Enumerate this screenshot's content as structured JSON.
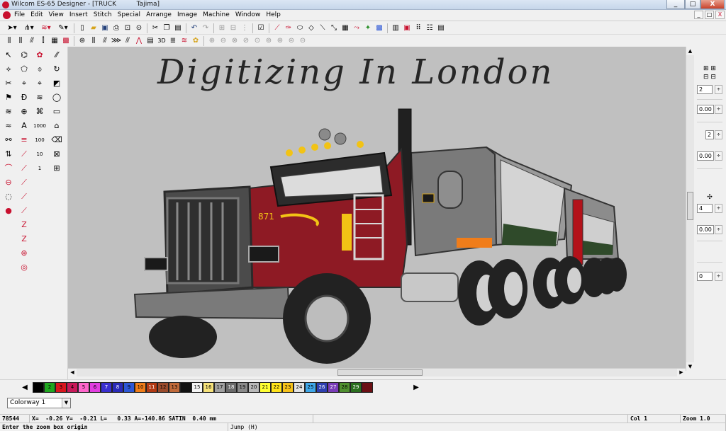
{
  "window": {
    "title": "Wilcom ES-65 Designer - [TRUCK          Tajima]",
    "minimize_glyph": "_",
    "maximize_glyph": "□",
    "close_glyph": "X"
  },
  "menu": {
    "items": [
      "File",
      "Edit",
      "View",
      "Insert",
      "Stitch",
      "Special",
      "Arrange",
      "Image",
      "Machine",
      "Window",
      "Help"
    ],
    "mdi_min": "_",
    "mdi_restore": "□",
    "mdi_close": "X"
  },
  "toolbar": {
    "rows": [
      [
        "select-arrow-icon",
        "stitch-tool-icon",
        "fill-tool-icon",
        "pen-icon",
        "new-file-icon",
        "open-folder-icon",
        "save-icon",
        "print-icon",
        "print-preview-icon",
        "zoom-icon",
        "cut-icon",
        "copy-icon",
        "paste-icon",
        "undo-icon",
        "redo-icon",
        "group-icon",
        "ungroup-icon",
        "align-icon",
        "checkbox-icon",
        "needle-icon",
        "brush-icon",
        "outline-icon",
        "shape-icon",
        "wand-icon",
        "grid-icon",
        "redraw-icon",
        "color-icon",
        "picture-icon",
        "layout-icon",
        "palette-icon",
        "thread-icon",
        "options-icon"
      ],
      [
        "run-stitch-icon",
        "fill-stitch-icon",
        "satin-icon",
        "column-icon",
        "tatami-icon",
        "motif-icon",
        "pattern-icon",
        "stamp-icon",
        "cross-stitch-icon",
        "zigzag-icon",
        "fan-icon",
        "triangle-icon",
        "shape-fill-icon",
        "3d-icon",
        "embossed-icon",
        "contour-icon",
        "sequin-icon",
        "corner-icon",
        "chain-icon",
        "spiral-icon",
        "star-icon",
        "stipple-icon",
        "gradient-icon",
        "offset-icon"
      ]
    ],
    "row2_text": "3D"
  },
  "left_tools": {
    "col1": [
      "↖",
      "⟡",
      "✂",
      "⚑",
      "≋",
      "≈",
      "⚯",
      "⇅",
      "⌒",
      "⊖",
      "◌",
      "●"
    ],
    "col2": [
      "⌬",
      "⬠",
      "⌖",
      "Ð",
      "⊕",
      "A",
      "≡",
      "⟋",
      "⟋",
      "⟋",
      "⟋",
      "⟋",
      "Z",
      "Z",
      "⊛",
      "◎"
    ],
    "col3": [
      "✿",
      "⌽",
      "⌖",
      "≋",
      "⌘",
      "1000",
      "100",
      "10",
      "1"
    ],
    "col4": [
      "⁄⁄",
      "↻",
      "◩",
      "◯",
      "▭",
      "⌂",
      "⌫",
      "⊠",
      "⊞"
    ]
  },
  "canvas": {
    "heading": "Digitizing In London",
    "truck_number": "871"
  },
  "colors": {
    "canvas_bg": "#c0c0c0",
    "truck_red": "#8e1a24",
    "truck_dark": "#2c2c2c",
    "trailer_grey": "#8c8c8c",
    "accent_yellow": "#f2c315"
  },
  "right_panel": {
    "fields": [
      "2",
      "0.00",
      "2",
      "0.00",
      "4",
      "0.00",
      "0"
    ]
  },
  "palette": {
    "swatches": [
      {
        "label": "",
        "color": "#000000"
      },
      {
        "label": "2",
        "color": "#1fa61f"
      },
      {
        "label": "3",
        "color": "#d8161e"
      },
      {
        "label": "4",
        "color": "#c81a5a"
      },
      {
        "label": "5",
        "color": "#ff66cc"
      },
      {
        "label": "6",
        "color": "#e23ee0"
      },
      {
        "label": "7",
        "color": "#3a2fd0"
      },
      {
        "label": "8",
        "color": "#2a2ab8"
      },
      {
        "label": "9",
        "color": "#2d57d6"
      },
      {
        "label": "10",
        "color": "#f07d1a"
      },
      {
        "label": "11",
        "color": "#b23a14"
      },
      {
        "label": "12",
        "color": "#9a4b2c"
      },
      {
        "label": "13",
        "color": "#c06a3a"
      },
      {
        "label": "",
        "color": "#111111"
      },
      {
        "label": "15",
        "color": "#f5f5f5"
      },
      {
        "label": "16",
        "color": "#f6e27a"
      },
      {
        "label": "17",
        "color": "#a0a0a0"
      },
      {
        "label": "18",
        "color": "#6a6a6a"
      },
      {
        "label": "19",
        "color": "#8a8a8a"
      },
      {
        "label": "20",
        "color": "#b9b9b9"
      },
      {
        "label": "21",
        "color": "#ffff33"
      },
      {
        "label": "22",
        "color": "#ffe31a"
      },
      {
        "label": "23",
        "color": "#f6c21a"
      },
      {
        "label": "24",
        "color": "#e4e4e4"
      },
      {
        "label": "25",
        "color": "#3fa7e8"
      },
      {
        "label": "26",
        "color": "#2e3fb0"
      },
      {
        "label": "27",
        "color": "#7a3cb8"
      },
      {
        "label": "28",
        "color": "#4f8f2f"
      },
      {
        "label": "29",
        "color": "#2a6e1e"
      },
      {
        "label": "",
        "color": "#6b0f14"
      }
    ],
    "prev_glyph": "◀",
    "next_glyph": "▶"
  },
  "colorway": {
    "value": "Colorway 1",
    "arrow": "▼"
  },
  "status": {
    "stitches": "78544",
    "coords": "X=  -0.26 Y=  -0.21 L=   0.33 A=-140.86 SATIN  0.40 mm",
    "col": "Col 1",
    "zoom": "Zoom 1.0",
    "prompt": "Enter the zoom box origin",
    "mode": "Jump (H)"
  }
}
